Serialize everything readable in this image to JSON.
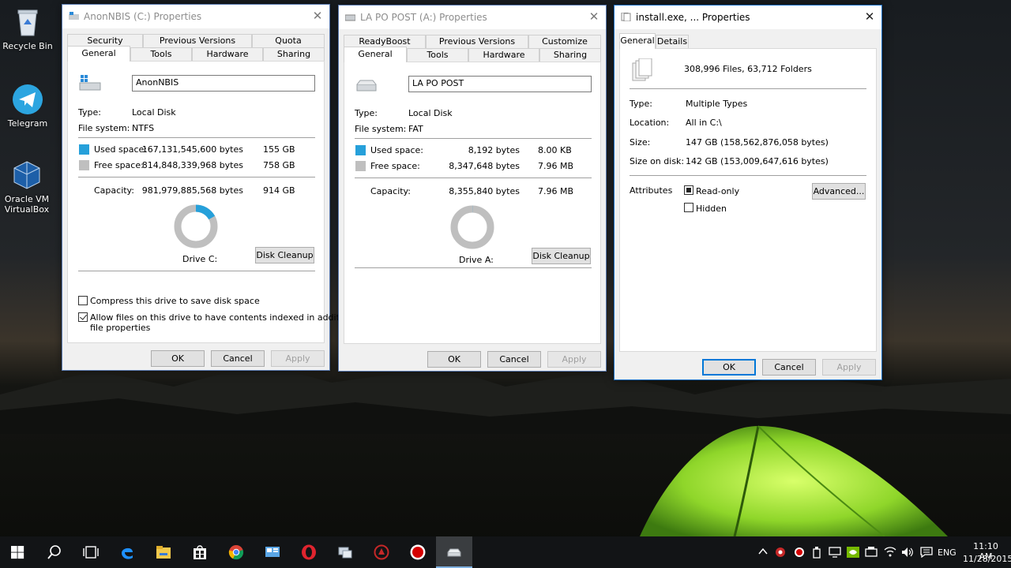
{
  "desktop": {
    "icons": [
      {
        "label": "Recycle Bin"
      },
      {
        "label": "Telegram"
      },
      {
        "label": "Oracle VM VirtualBox"
      }
    ]
  },
  "win_c": {
    "title": "AnonNBIS (C:) Properties",
    "tabs_top": [
      "Security",
      "Previous Versions",
      "Quota"
    ],
    "tabs_bottom": [
      "General",
      "Tools",
      "Hardware",
      "Sharing"
    ],
    "name_value": "AnonNBIS",
    "type_label": "Type:",
    "type_value": "Local Disk",
    "fs_label": "File system:",
    "fs_value": "NTFS",
    "used_label": "Used space:",
    "used_bytes": "167,131,545,600 bytes",
    "used_gb": "155 GB",
    "free_label": "Free space:",
    "free_bytes": "814,848,339,968 bytes",
    "free_gb": "758 GB",
    "cap_label": "Capacity:",
    "cap_bytes": "981,979,885,568 bytes",
    "cap_gb": "914 GB",
    "used_fraction": 0.17,
    "drive_label": "Drive C:",
    "cleanup": "Disk Cleanup",
    "compress": "Compress this drive to save disk space",
    "index_line1": "Allow files on this drive to have contents indexed in addition to",
    "index_line2": "file properties",
    "ok": "OK",
    "cancel": "Cancel",
    "apply": "Apply"
  },
  "win_a": {
    "title": "LA PO POST (A:) Properties",
    "tabs_top": [
      "ReadyBoost",
      "Previous Versions",
      "Customize"
    ],
    "tabs_bottom": [
      "General",
      "Tools",
      "Hardware",
      "Sharing"
    ],
    "name_value": "LA PO POST",
    "type_label": "Type:",
    "type_value": "Local Disk",
    "fs_label": "File system:",
    "fs_value": "FAT",
    "used_label": "Used space:",
    "used_bytes": "8,192 bytes",
    "used_gb": "8.00 KB",
    "free_label": "Free space:",
    "free_bytes": "8,347,648 bytes",
    "free_gb": "7.96 MB",
    "cap_label": "Capacity:",
    "cap_bytes": "8,355,840 bytes",
    "cap_gb": "7.96 MB",
    "used_fraction": 0.001,
    "drive_label": "Drive A:",
    "cleanup": "Disk Cleanup",
    "ok": "OK",
    "cancel": "Cancel",
    "apply": "Apply"
  },
  "win_f": {
    "title": "install.exe, ... Properties",
    "tabs": [
      "General",
      "Details"
    ],
    "summary": "308,996 Files, 63,712 Folders",
    "type_label": "Type:",
    "type_value": "Multiple Types",
    "loc_label": "Location:",
    "loc_value": "All in C:\\",
    "size_label": "Size:",
    "size_value": "147 GB (158,562,876,058 bytes)",
    "sod_label": "Size on disk:",
    "sod_value": "142 GB (153,009,647,616 bytes)",
    "attr_label": "Attributes",
    "readonly": "Read-only",
    "hidden": "Hidden",
    "advanced": "Advanced...",
    "ok": "OK",
    "cancel": "Cancel",
    "apply": "Apply"
  },
  "colors": {
    "used": "#26a0da",
    "free": "#bfbfbf",
    "accent": "#0078d7"
  },
  "taskbar": {
    "items": [
      "start-icon",
      "search-icon",
      "task-view-icon",
      "edge-icon",
      "file-explorer-icon",
      "store-icon",
      "chrome-icon",
      "control-panel-icon",
      "opera-icon",
      "network-icon",
      "app-red-icon",
      "record-icon",
      "drive-icon"
    ],
    "lang": "ENG",
    "time": "11:10 AM",
    "date": "11/28/2015"
  }
}
